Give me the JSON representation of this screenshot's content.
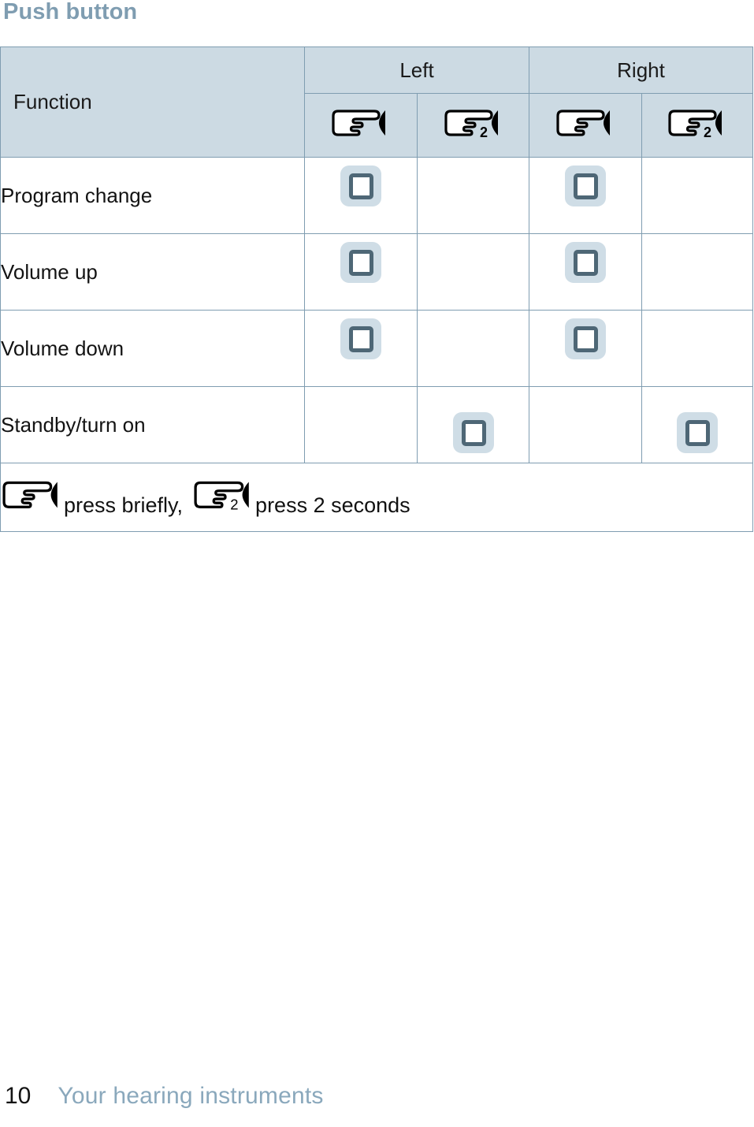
{
  "section": {
    "title": "Push button"
  },
  "table": {
    "columns": {
      "function_header": "Function",
      "groups": [
        {
          "label": "Left",
          "span": 2
        },
        {
          "label": "Right",
          "span": 2
        }
      ],
      "sub_headers": [
        {
          "icon": "hand-press-briefly-icon",
          "duration": ""
        },
        {
          "icon": "hand-press-2-seconds-icon",
          "duration": "2"
        },
        {
          "icon": "hand-press-briefly-icon",
          "duration": ""
        },
        {
          "icon": "hand-press-2-seconds-icon",
          "duration": "2"
        }
      ]
    },
    "rows": [
      {
        "function": "Program change",
        "marks": [
          true,
          false,
          true,
          false
        ],
        "align": "high"
      },
      {
        "function": "Volume up",
        "marks": [
          true,
          false,
          true,
          false
        ],
        "align": "high"
      },
      {
        "function": "Volume down",
        "marks": [
          true,
          false,
          true,
          false
        ],
        "align": "high"
      },
      {
        "function": "Standby/turn on",
        "marks": [
          false,
          true,
          false,
          true
        ],
        "align": "low"
      }
    ],
    "footnote": {
      "icon_brief": "hand-press-briefly-icon",
      "text_brief": "press briefly,",
      "icon_two_seconds": "hand-press-2-seconds-icon",
      "text_two_seconds": "press 2 seconds"
    }
  },
  "footer": {
    "page_number": "10",
    "label": "Your hearing instruments"
  },
  "colors": {
    "accent_blue": "#7f9db1",
    "header_fill": "#ccdae3",
    "border": "#7f9db1",
    "mark_bg": "#cfdde6",
    "mark_outline": "#4e6776",
    "footer_label": "#8aa8bc"
  }
}
